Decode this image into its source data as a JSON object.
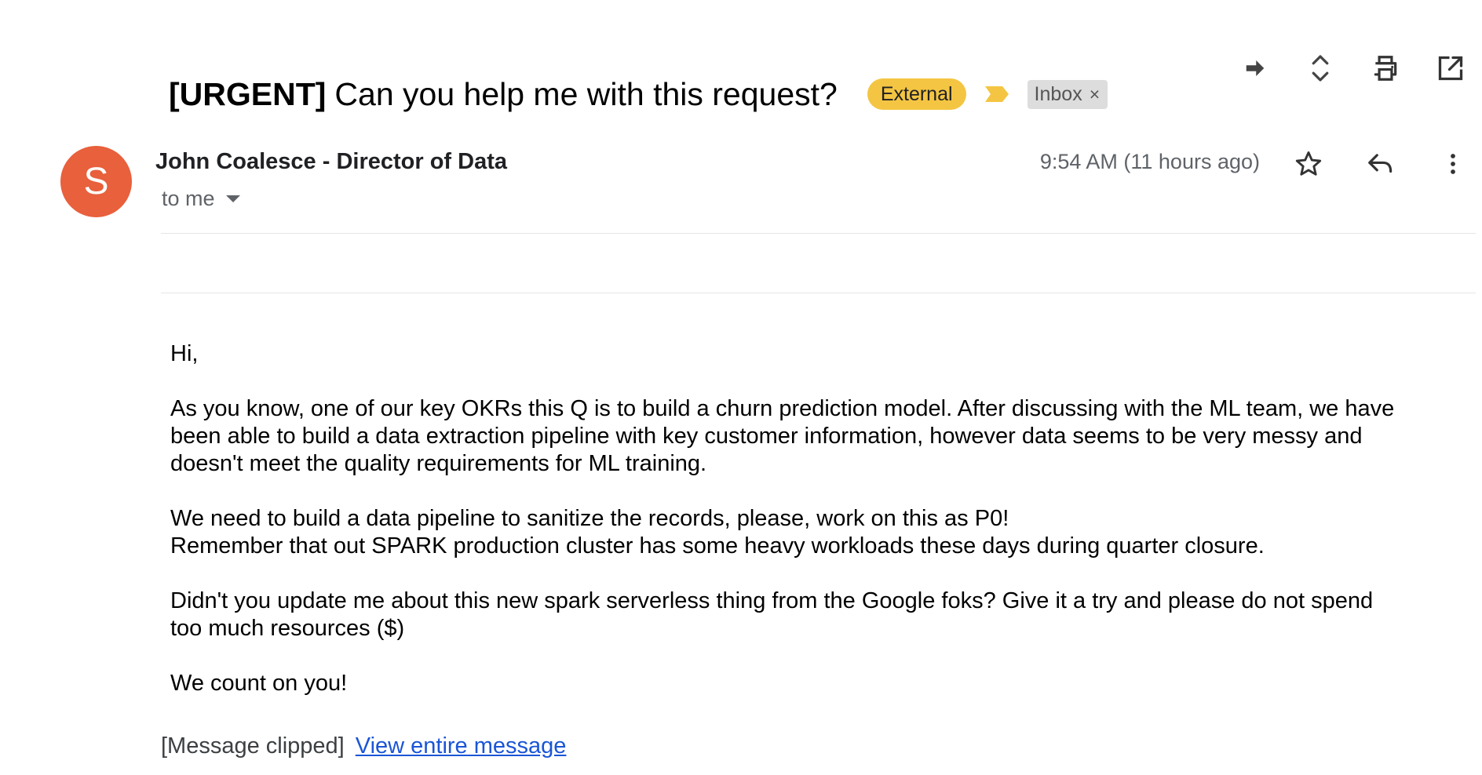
{
  "subject": {
    "tag": "[URGENT]",
    "text": "Can you help me with this request?",
    "labels": {
      "external": "External",
      "inbox": "Inbox",
      "inbox_remove": "×"
    }
  },
  "toolbar": {
    "icons": [
      "forward-arrow-icon",
      "expand-collapse-icon",
      "print-icon",
      "open-in-new-window-icon"
    ]
  },
  "sender": {
    "avatar_letter": "S",
    "avatar_color": "#e8603c",
    "name": "John Coalesce - Director of Data",
    "recipient": "to me",
    "timestamp": "9:54 AM (11 hours ago)"
  },
  "message_actions": {
    "icons": [
      "star-icon",
      "reply-icon",
      "more-vert-icon"
    ]
  },
  "body": {
    "greeting": "Hi,",
    "paragraph1": "As you know, one of our key OKRs this Q is to build a churn prediction model. After discussing with the ML team, we have been able to build a data extraction pipeline with key customer information, however data seems to be very messy and doesn't meet the quality requirements for ML training.",
    "paragraph2_line1": "We need to build a data pipeline to sanitize the records, please, work on this as P0!",
    "paragraph2_line2": "Remember that out SPARK production cluster has some heavy workloads these days during quarter closure.",
    "paragraph3": "Didn't you update me about this new spark serverless thing from the Google foks? Give it a try and please do not spend too much resources ($)",
    "closing": "We count on you!"
  },
  "clipped": {
    "notice": "[Message clipped]",
    "link": "View entire message"
  },
  "colors": {
    "external_label": "#f4c542",
    "importance_marker": "#f4c542",
    "inbox_label": "#dddddd",
    "link": "#1a55d6"
  }
}
